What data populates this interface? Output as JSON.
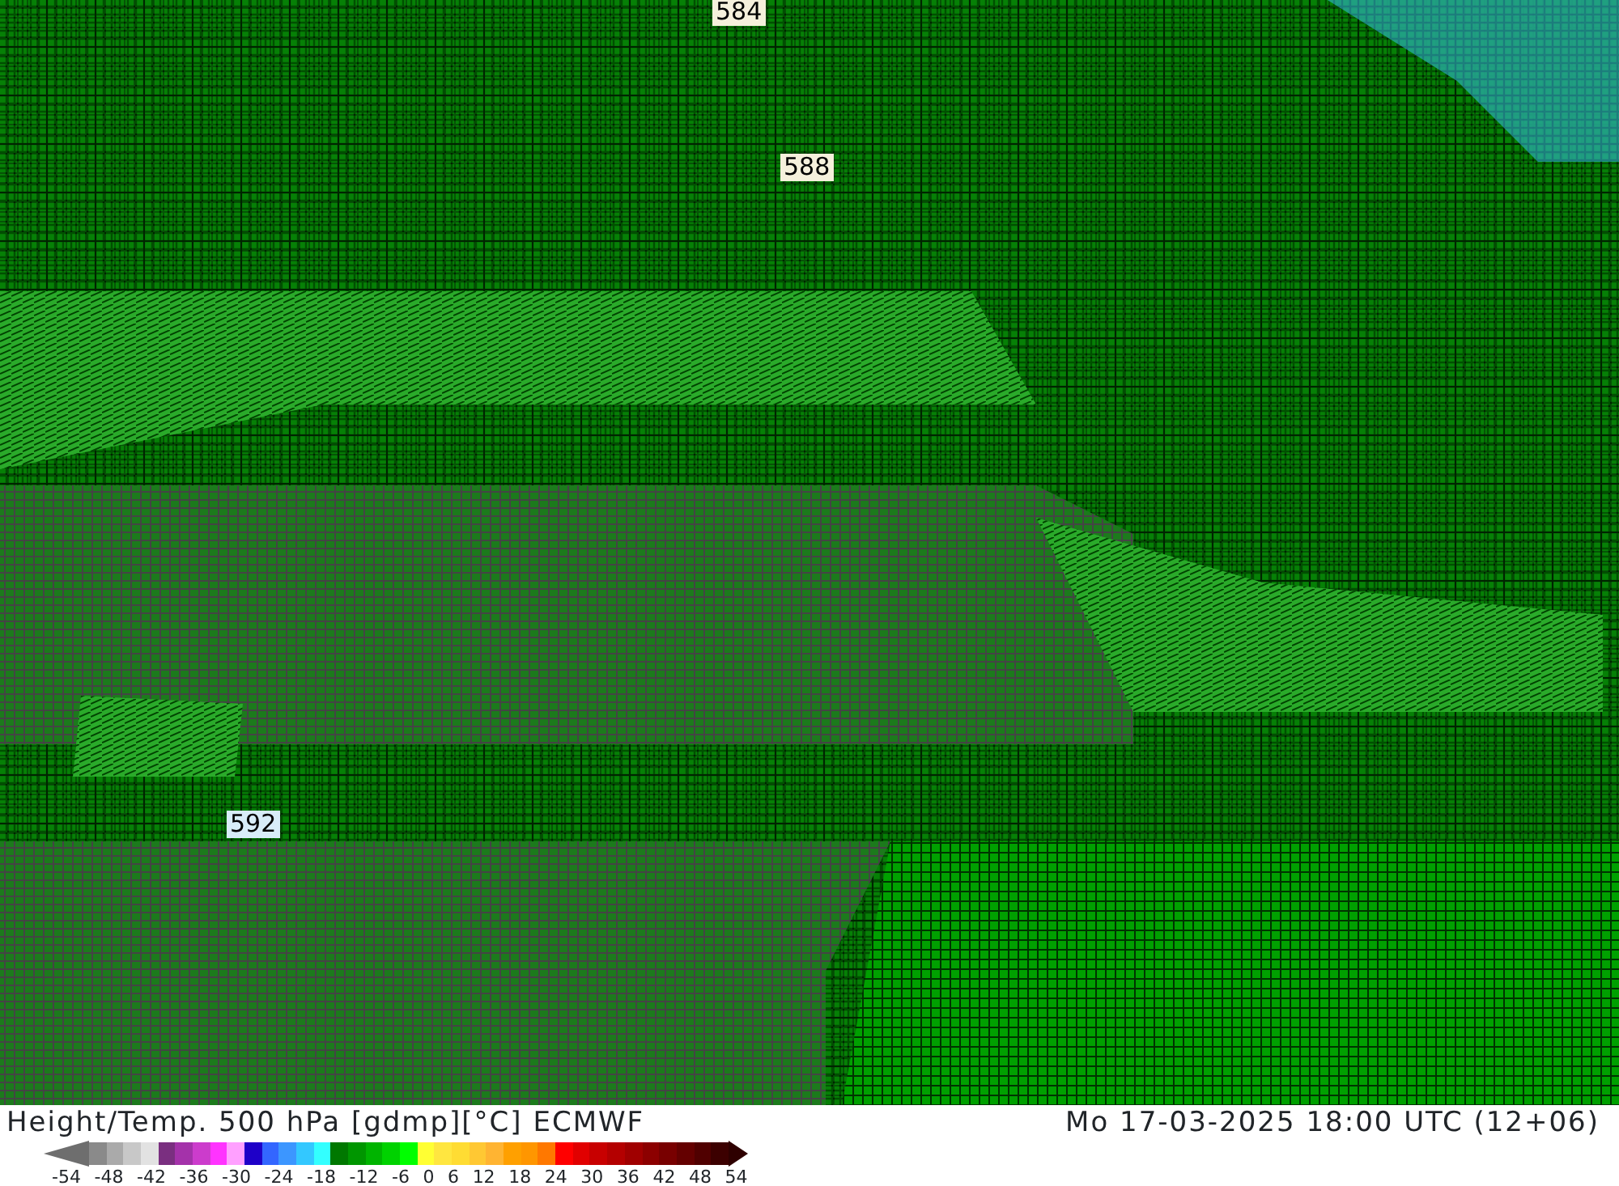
{
  "map": {
    "contour_labels": [
      {
        "text": "584",
        "color": "#f5f0dc"
      },
      {
        "text": "588",
        "color": "#f5f0dc"
      },
      {
        "text": "592",
        "color": "#d8ecf8"
      }
    ]
  },
  "footer": {
    "title": "Height/Temp. 500 hPa [gdmp][°C] ECMWF",
    "datetime": "Mo 17-03-2025 18:00 UTC (12+06)"
  },
  "legend": {
    "swatches": [
      {
        "kind": "low-arrow",
        "color": "#6e6e6e"
      },
      {
        "color": "#8a8a8a"
      },
      {
        "color": "#aaaaaa"
      },
      {
        "color": "#c8c8c8"
      },
      {
        "color": "#e2e2e2"
      },
      {
        "color": "#7a2f80"
      },
      {
        "color": "#a432aa"
      },
      {
        "color": "#cc3ccc"
      },
      {
        "color": "#ff33ff"
      },
      {
        "color": "#ffa0ff"
      },
      {
        "color": "#1e00c8"
      },
      {
        "color": "#3366ff"
      },
      {
        "color": "#3c96ff"
      },
      {
        "color": "#33c8ff"
      },
      {
        "color": "#33ffff"
      },
      {
        "color": "#007800"
      },
      {
        "color": "#009600"
      },
      {
        "color": "#00b400"
      },
      {
        "color": "#00d200"
      },
      {
        "color": "#00ff00"
      },
      {
        "color": "#ffff33"
      },
      {
        "color": "#ffe640"
      },
      {
        "color": "#ffdc33"
      },
      {
        "color": "#ffc833"
      },
      {
        "color": "#ffb432"
      },
      {
        "color": "#ffa000"
      },
      {
        "color": "#ff9600"
      },
      {
        "color": "#ff7800"
      },
      {
        "color": "#ff0000"
      },
      {
        "color": "#e10000"
      },
      {
        "color": "#c80000"
      },
      {
        "color": "#b40000"
      },
      {
        "color": "#a00000"
      },
      {
        "color": "#8c0000"
      },
      {
        "color": "#780000"
      },
      {
        "color": "#640000"
      },
      {
        "color": "#500000"
      },
      {
        "color": "#3c0000"
      },
      {
        "kind": "high-arrow",
        "color": "#2e0000"
      }
    ],
    "ticks": [
      "-54",
      "-48",
      "-42",
      "-36",
      "-30",
      "-24",
      "-18",
      "-12",
      "-6",
      "0",
      "6",
      "12",
      "18",
      "24",
      "30",
      "36",
      "42",
      "48",
      "54"
    ]
  }
}
